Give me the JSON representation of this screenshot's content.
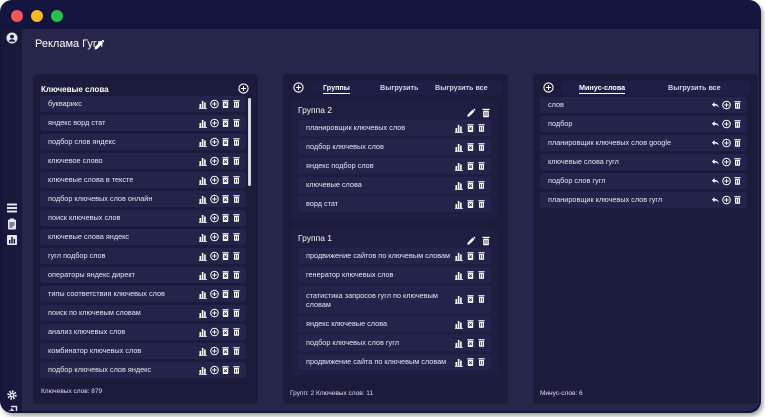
{
  "page_title": "Реклама Гугл",
  "keywords_panel": {
    "header": "Ключевые слова",
    "items": [
      "букварикс",
      "яндекс ворд стат",
      "подбор слов яндекс",
      "ключевое слово",
      "ключевые слова в тексте",
      "подбор ключевых слов онлайн",
      "поиск ключевых слов",
      "ключевые слова яндекс",
      "гугл подбор слов",
      "операторы яндекс директ",
      "типы соответствия ключевых слов",
      "поиск по ключевым словам",
      "анализ ключевых слов",
      "комбинатор ключевых слов",
      "подбор ключевых слов яндекс"
    ],
    "footer": "Ключевых слов: 879"
  },
  "groups_panel": {
    "tabs": [
      "Группы",
      "Выгрузить",
      "Выгрузить все"
    ],
    "active_tab": "Группы",
    "groups": [
      {
        "title": "Группа 2",
        "items": [
          "планировщик ключевых слов",
          "подбор ключевых слов",
          "яндекс подбор слов",
          "ключевые слова",
          "ворд стат"
        ]
      },
      {
        "title": "Группа 1",
        "items": [
          "продвижение сайтов по ключевым словам",
          "генератор ключевых слов",
          "статистика запросов гугл по ключевым словам",
          "яндекс ключевые слова",
          "подбор ключевых слов гугл",
          "продвижение сайта по ключевым словам"
        ]
      }
    ],
    "footer": "Групп: 2 Ключевых слов: 11"
  },
  "minus_panel": {
    "tabs": [
      "Минус-слова",
      "Выгрузить все"
    ],
    "active_tab": "Минус-слова",
    "items": [
      "слов",
      "подбор",
      "планировщик ключевых слов google",
      "ключевые слова гугл",
      "подбор слов гугл",
      "планировщик ключевых слов гугл"
    ],
    "footer": "Минус-слов: 6"
  },
  "icons": {
    "sidebar": [
      "account-icon",
      "list-icon",
      "clipboard-icon",
      "chart-icon",
      "settings-icon",
      "logout-icon"
    ],
    "row_actions": [
      "chart-icon",
      "add-circle-icon",
      "delete-icon",
      "trash-icon"
    ],
    "minus_actions": [
      "undo-icon",
      "add-circle-icon",
      "trash-icon"
    ]
  },
  "colors": {
    "window_bg": "#25264a",
    "titlebar": "#14153e",
    "panel_bg": "#1b1c3c",
    "row_bg": "#23244a",
    "close": "#f0555a",
    "minimize": "#f2b928",
    "maximize": "#28c14b"
  }
}
